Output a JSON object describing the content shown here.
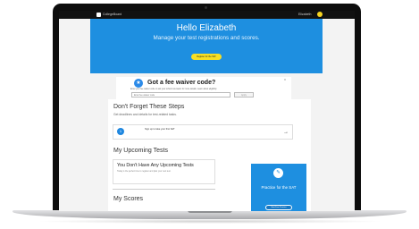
{
  "header": {
    "brand": "CollegeBoard",
    "username": "Elizabeth"
  },
  "hero": {
    "title": "Hello Elizabeth",
    "subtitle": "Manage your test registrations and scores.",
    "button_label": "Register for the SAT"
  },
  "fee_waiver": {
    "title": "Got a fee waiver code?",
    "description": "Enter your fee waiver code or ask your school counselor for more details. Learn about eligibility",
    "input_placeholder": "Enter fee waiver code",
    "apply_label": "Apply",
    "close_label": "x"
  },
  "steps": {
    "title": "Don't Forget These Steps",
    "subtitle": "Get deadlines and details for test-related tasks.",
    "items": [
      {
        "number": "1",
        "label": "Sign up to take your first SAT"
      }
    ]
  },
  "upcoming": {
    "title": "My Upcoming Tests",
    "empty_title": "You Don't Have Any Upcoming Tests",
    "empty_text": "Today is the perfect time to register and plan your next test."
  },
  "scores": {
    "title": "My Scores"
  },
  "practice": {
    "title": "Practice for the SAT",
    "button_label": "Start Free Practice"
  },
  "colors": {
    "accent_blue": "#1e8fe0",
    "yellow": "#f8df24"
  }
}
